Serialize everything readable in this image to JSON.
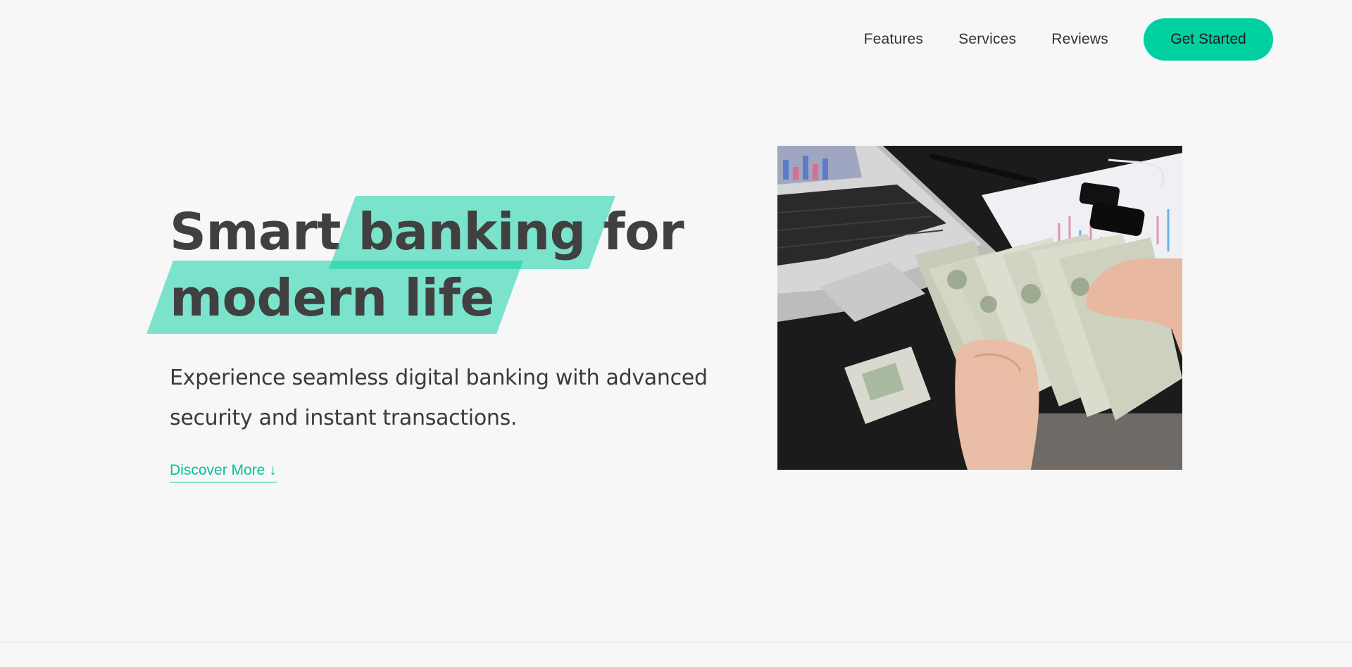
{
  "nav": {
    "links": [
      "Features",
      "Services",
      "Reviews"
    ],
    "cta_label": "Get Started"
  },
  "hero": {
    "title_line1_pre": "Smart ",
    "title_line1_highlight": "banking",
    "title_line1_post": " for",
    "title_line2_highlight": "modern life",
    "subtitle": "Experience seamless digital banking with advanced security and instant transactions.",
    "discover_label": "Discover More ↓"
  },
  "colors": {
    "accent": "#00cfa0",
    "background": "#f7f7f7",
    "text": "#404040"
  }
}
